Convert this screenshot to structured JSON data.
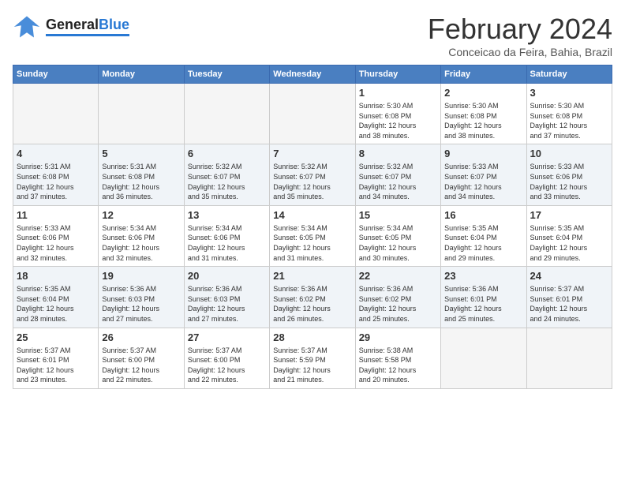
{
  "header": {
    "logo_general": "General",
    "logo_blue": "Blue",
    "month_title": "February 2024",
    "subtitle": "Conceicao da Feira, Bahia, Brazil"
  },
  "days_of_week": [
    "Sunday",
    "Monday",
    "Tuesday",
    "Wednesday",
    "Thursday",
    "Friday",
    "Saturday"
  ],
  "weeks": [
    [
      {
        "day": "",
        "info": ""
      },
      {
        "day": "",
        "info": ""
      },
      {
        "day": "",
        "info": ""
      },
      {
        "day": "",
        "info": ""
      },
      {
        "day": "1",
        "info": "Sunrise: 5:30 AM\nSunset: 6:08 PM\nDaylight: 12 hours\nand 38 minutes."
      },
      {
        "day": "2",
        "info": "Sunrise: 5:30 AM\nSunset: 6:08 PM\nDaylight: 12 hours\nand 38 minutes."
      },
      {
        "day": "3",
        "info": "Sunrise: 5:30 AM\nSunset: 6:08 PM\nDaylight: 12 hours\nand 37 minutes."
      }
    ],
    [
      {
        "day": "4",
        "info": "Sunrise: 5:31 AM\nSunset: 6:08 PM\nDaylight: 12 hours\nand 37 minutes."
      },
      {
        "day": "5",
        "info": "Sunrise: 5:31 AM\nSunset: 6:08 PM\nDaylight: 12 hours\nand 36 minutes."
      },
      {
        "day": "6",
        "info": "Sunrise: 5:32 AM\nSunset: 6:07 PM\nDaylight: 12 hours\nand 35 minutes."
      },
      {
        "day": "7",
        "info": "Sunrise: 5:32 AM\nSunset: 6:07 PM\nDaylight: 12 hours\nand 35 minutes."
      },
      {
        "day": "8",
        "info": "Sunrise: 5:32 AM\nSunset: 6:07 PM\nDaylight: 12 hours\nand 34 minutes."
      },
      {
        "day": "9",
        "info": "Sunrise: 5:33 AM\nSunset: 6:07 PM\nDaylight: 12 hours\nand 34 minutes."
      },
      {
        "day": "10",
        "info": "Sunrise: 5:33 AM\nSunset: 6:06 PM\nDaylight: 12 hours\nand 33 minutes."
      }
    ],
    [
      {
        "day": "11",
        "info": "Sunrise: 5:33 AM\nSunset: 6:06 PM\nDaylight: 12 hours\nand 32 minutes."
      },
      {
        "day": "12",
        "info": "Sunrise: 5:34 AM\nSunset: 6:06 PM\nDaylight: 12 hours\nand 32 minutes."
      },
      {
        "day": "13",
        "info": "Sunrise: 5:34 AM\nSunset: 6:06 PM\nDaylight: 12 hours\nand 31 minutes."
      },
      {
        "day": "14",
        "info": "Sunrise: 5:34 AM\nSunset: 6:05 PM\nDaylight: 12 hours\nand 31 minutes."
      },
      {
        "day": "15",
        "info": "Sunrise: 5:34 AM\nSunset: 6:05 PM\nDaylight: 12 hours\nand 30 minutes."
      },
      {
        "day": "16",
        "info": "Sunrise: 5:35 AM\nSunset: 6:04 PM\nDaylight: 12 hours\nand 29 minutes."
      },
      {
        "day": "17",
        "info": "Sunrise: 5:35 AM\nSunset: 6:04 PM\nDaylight: 12 hours\nand 29 minutes."
      }
    ],
    [
      {
        "day": "18",
        "info": "Sunrise: 5:35 AM\nSunset: 6:04 PM\nDaylight: 12 hours\nand 28 minutes."
      },
      {
        "day": "19",
        "info": "Sunrise: 5:36 AM\nSunset: 6:03 PM\nDaylight: 12 hours\nand 27 minutes."
      },
      {
        "day": "20",
        "info": "Sunrise: 5:36 AM\nSunset: 6:03 PM\nDaylight: 12 hours\nand 27 minutes."
      },
      {
        "day": "21",
        "info": "Sunrise: 5:36 AM\nSunset: 6:02 PM\nDaylight: 12 hours\nand 26 minutes."
      },
      {
        "day": "22",
        "info": "Sunrise: 5:36 AM\nSunset: 6:02 PM\nDaylight: 12 hours\nand 25 minutes."
      },
      {
        "day": "23",
        "info": "Sunrise: 5:36 AM\nSunset: 6:01 PM\nDaylight: 12 hours\nand 25 minutes."
      },
      {
        "day": "24",
        "info": "Sunrise: 5:37 AM\nSunset: 6:01 PM\nDaylight: 12 hours\nand 24 minutes."
      }
    ],
    [
      {
        "day": "25",
        "info": "Sunrise: 5:37 AM\nSunset: 6:01 PM\nDaylight: 12 hours\nand 23 minutes."
      },
      {
        "day": "26",
        "info": "Sunrise: 5:37 AM\nSunset: 6:00 PM\nDaylight: 12 hours\nand 22 minutes."
      },
      {
        "day": "27",
        "info": "Sunrise: 5:37 AM\nSunset: 6:00 PM\nDaylight: 12 hours\nand 22 minutes."
      },
      {
        "day": "28",
        "info": "Sunrise: 5:37 AM\nSunset: 5:59 PM\nDaylight: 12 hours\nand 21 minutes."
      },
      {
        "day": "29",
        "info": "Sunrise: 5:38 AM\nSunset: 5:58 PM\nDaylight: 12 hours\nand 20 minutes."
      },
      {
        "day": "",
        "info": ""
      },
      {
        "day": "",
        "info": ""
      }
    ]
  ]
}
